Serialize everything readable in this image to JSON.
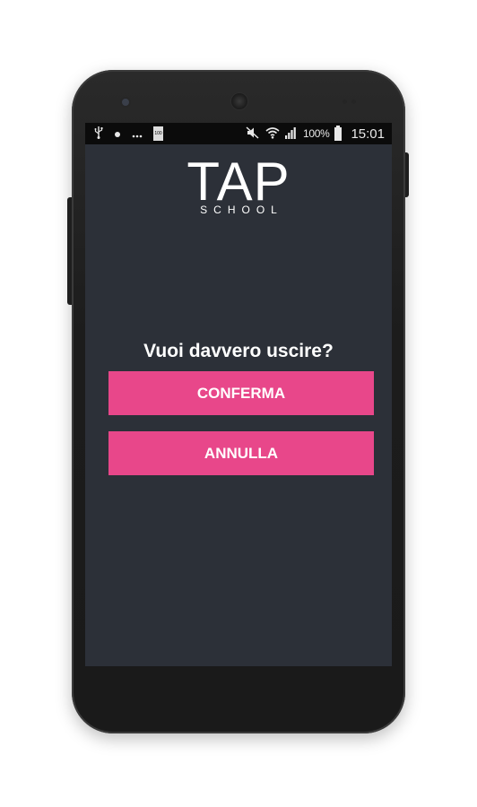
{
  "status_bar": {
    "left_icons": [
      "usb-icon",
      "dot-icon",
      "more-icon",
      "battery-saver-icon"
    ],
    "battery_small_label": "100",
    "right_icons": [
      "mute-icon",
      "wifi-icon",
      "signal-icon"
    ],
    "battery_percent": "100%",
    "time": "15:01"
  },
  "logo": {
    "main": "TAP",
    "sub": "SCHOOL"
  },
  "dialog": {
    "question": "Vuoi davvero uscire?",
    "confirm_label": "CONFERMA",
    "cancel_label": "ANNULLA"
  },
  "colors": {
    "accent": "#e8478a",
    "background": "#2c3038",
    "status_bar": "#0b0b0b"
  }
}
